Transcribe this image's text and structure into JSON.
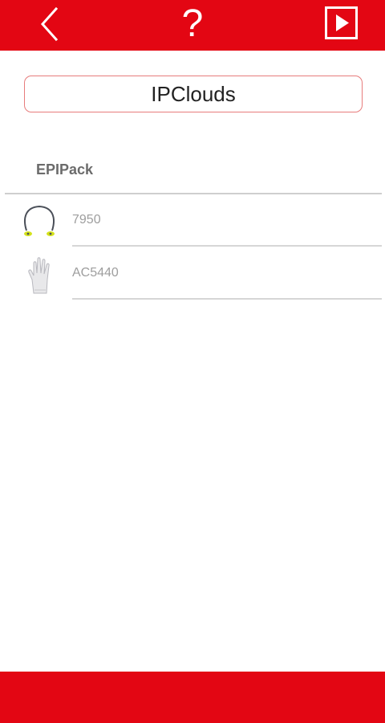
{
  "header": {
    "back_icon": "chevron-left-icon",
    "help_label": "?",
    "play_icon": "play-icon",
    "background": "#e30613"
  },
  "title_field": {
    "value": "IPClouds",
    "border_color": "#e77c7c"
  },
  "section": {
    "title": "EPIPack"
  },
  "items": [
    {
      "label": "7950",
      "icon": "earplugs-icon"
    },
    {
      "label": "AC5440",
      "icon": "glove-icon"
    }
  ],
  "footer": {
    "background": "#e30613"
  }
}
